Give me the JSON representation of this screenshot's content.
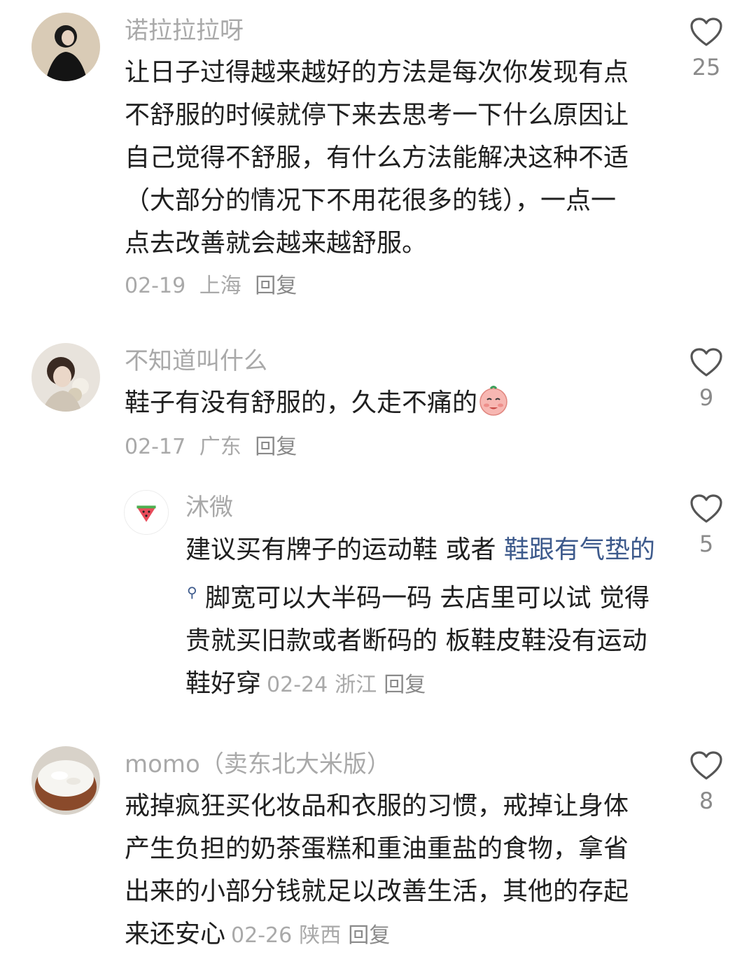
{
  "comments": [
    {
      "username": "诺拉拉拉呀",
      "text": "让日子过得越来越好的方法是每次你发现有点不舒服的时候就停下来去思考一下什么原因让自己觉得不舒服，有什么方法能解决这种不适（大部分的情况下不用花很多的钱），一点一点去改善就会越来越舒服。",
      "date": "02-19",
      "location": "上海",
      "reply_label": "回复",
      "likes": "25"
    },
    {
      "username": "不知道叫什么",
      "text": "鞋子有没有舒服的，久走不痛的",
      "emoji": "smiling-face-emoji",
      "date": "02-17",
      "location": "广东",
      "reply_label": "回复",
      "likes": "9"
    },
    {
      "username": "沐微",
      "text_before": "建议买有牌子的运动鞋 或者 ",
      "link_text": "鞋跟有气垫的",
      "text_after": " 脚宽可以大半码一码 去店里可以试 觉得贵就买旧款或者断码的 板鞋皮鞋没有运动鞋好穿",
      "date": "02-24",
      "location": "浙江",
      "reply_label": "回复",
      "likes": "5"
    },
    {
      "username": "momo（卖东北大米版）",
      "text": "戒掉疯狂买化妆品和衣服的习惯，戒掉让身体产生负担的奶茶蛋糕和重油重盐的食物，拿省出来的小部分钱就足以改善生活，其他的存起来还安心",
      "date": "02-26",
      "location": "陕西",
      "reply_label": "回复",
      "likes": "8"
    }
  ],
  "icons": {
    "like": "heart-outline-icon",
    "search": "search-icon"
  },
  "colors": {
    "primary_text": "#1f1f1f",
    "secondary_text": "#a9a9a9",
    "link": "#3d5a8c"
  }
}
